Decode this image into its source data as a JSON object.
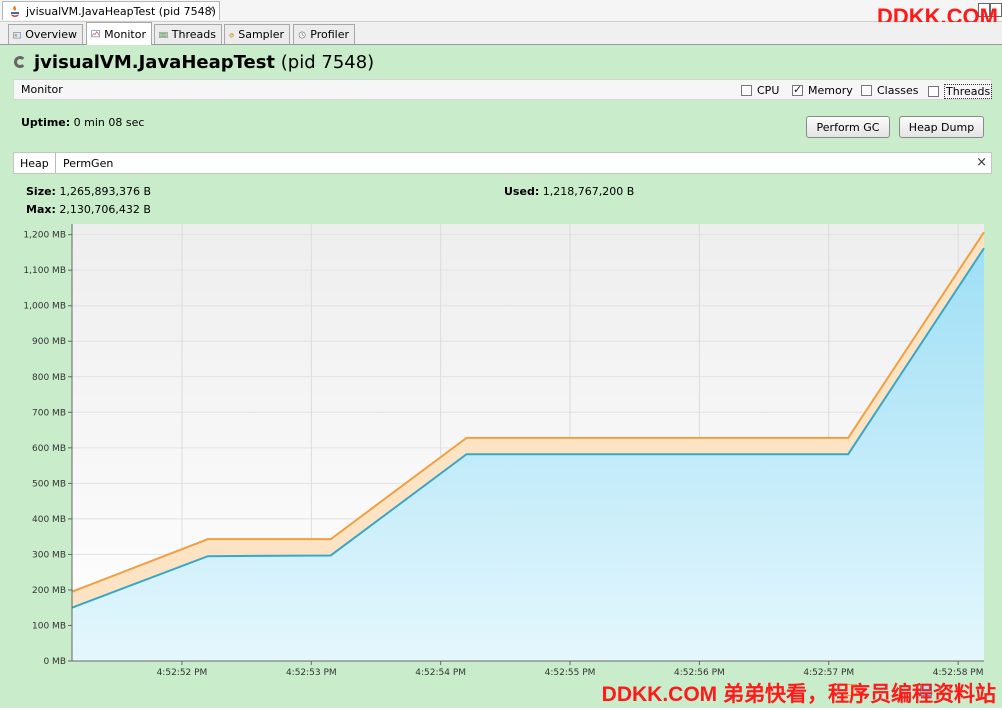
{
  "window": {
    "doc_tab_title": "jvisualVM.JavaHeapTest (pid 7548)",
    "doc_tab_close": "×"
  },
  "watermark": {
    "top": "DDKK.COM",
    "bottom": "DDKK.COM 弟弟快看，程序员编程资料站"
  },
  "tabs": [
    {
      "label": "Overview",
      "icon": "overview-icon",
      "active": false
    },
    {
      "label": "Monitor",
      "icon": "monitor-icon",
      "active": true
    },
    {
      "label": "Threads",
      "icon": "threads-icon",
      "active": false
    },
    {
      "label": "Sampler",
      "icon": "sampler-icon",
      "active": false
    },
    {
      "label": "Profiler",
      "icon": "profiler-icon",
      "active": false
    }
  ],
  "app": {
    "name": "jvisualVM.JavaHeapTest",
    "pid": "(pid 7548)"
  },
  "monitor": {
    "label": "Monitor",
    "checkboxes": [
      {
        "label": "CPU",
        "checked": false
      },
      {
        "label": "Memory",
        "checked": true
      },
      {
        "label": "Classes",
        "checked": false
      },
      {
        "label": "Threads",
        "checked": false
      }
    ]
  },
  "uptime": {
    "label": "Uptime:",
    "value": "0 min 08 sec"
  },
  "buttons": {
    "gc": "Perform GC",
    "heap_dump": "Heap Dump"
  },
  "heap_tabs": [
    "Heap",
    "PermGen"
  ],
  "heap_tab_close": "×",
  "stats": {
    "size_label": "Size:",
    "size_value": "1,265,893,376 B",
    "max_label": "Max:",
    "max_value": "2,130,706,432 B",
    "used_label": "Used:",
    "used_value": "1,218,767,200 B"
  },
  "colors": {
    "green_bg": "#c9eccb",
    "heap_size_line": "#f0a040",
    "heap_size_fill": "#fbe3c4",
    "used_line": "#3aa6c8",
    "used_fill": "#a9e3f6"
  },
  "chart_data": {
    "type": "area",
    "y_ticks": [
      "0 MB",
      "100 MB",
      "200 MB",
      "300 MB",
      "400 MB",
      "500 MB",
      "600 MB",
      "700 MB",
      "800 MB",
      "900 MB",
      "1,000 MB",
      "1,100 MB",
      "1,200 MB"
    ],
    "ylim": [
      0,
      1230
    ],
    "x_ticks": [
      "4:52:52 PM",
      "4:52:53 PM",
      "4:52:54 PM",
      "4:52:55 PM",
      "4:52:56 PM",
      "4:52:57 PM",
      "4:52:58 PM"
    ],
    "xlim": [
      "4:52:51.15 PM",
      "4:52:58.20 PM"
    ],
    "series": [
      {
        "kind": "heap-size",
        "x": [
          "4:52:51.15 PM",
          "4:52:52.20 PM",
          "4:52:53.15 PM",
          "4:52:54.20 PM",
          "4:52:57.15 PM",
          "4:52:58.20 PM"
        ],
        "values": [
          195,
          343,
          343,
          628,
          628,
          1207
        ]
      },
      {
        "kind": "used-heap",
        "x": [
          "4:52:51.15 PM",
          "4:52:52.20 PM",
          "4:52:53.15 PM",
          "4:52:54.20 PM",
          "4:52:57.15 PM",
          "4:52:58.20 PM"
        ],
        "values": [
          150,
          295,
          297,
          582,
          582,
          1162
        ]
      }
    ]
  }
}
